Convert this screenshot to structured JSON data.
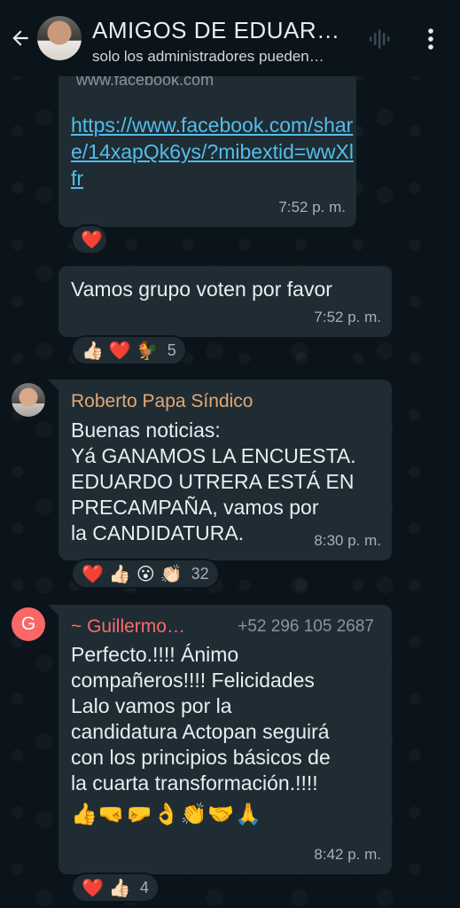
{
  "header": {
    "title": "AMIGOS DE EDUAR…",
    "subtitle": "solo los administradores pueden…"
  },
  "messages": [
    {
      "link_preview_url": "www.facebook.com",
      "link": "https://www.facebook.com/share/14xapQk6ys/?mibextid=wwXlfr",
      "time": "7:52 p. m.",
      "reactions": [
        "❤️"
      ]
    },
    {
      "text": "Vamos grupo voten por favor",
      "time": "7:52 p. m.",
      "reactions": [
        "👍🏻",
        "❤️",
        "🐓"
      ],
      "reaction_count": "5"
    },
    {
      "sender": "Roberto Papa Síndico",
      "text": "Buenas noticias:\nYá GANAMOS LA ENCUESTA.\nEDUARDO UTRERA ESTÁ EN\nPRECAMPAÑA,  vamos por\nla CANDIDATURA.",
      "time": "8:30 p. m.",
      "reactions": [
        "❤️",
        "👍🏻",
        "😮",
        "👏🏻"
      ],
      "reaction_count": "32"
    },
    {
      "sender": "~ Guillermo…",
      "sender_initial": "G",
      "phone": "+52 296 105 2687",
      "text": "Perfecto.!!!!   Ánimo\ncompañeros!!!! Felicidades\nLalo vamos por la\ncandidatura Actopan seguirá\ncon los principios básicos de\nla cuarta transformación.!!!!",
      "emoji_line": "👍🤜🤛👌👏🤝🙏",
      "time": "8:42 p. m.",
      "reactions": [
        "❤️",
        "👍🏻"
      ],
      "reaction_count": "4"
    }
  ]
}
